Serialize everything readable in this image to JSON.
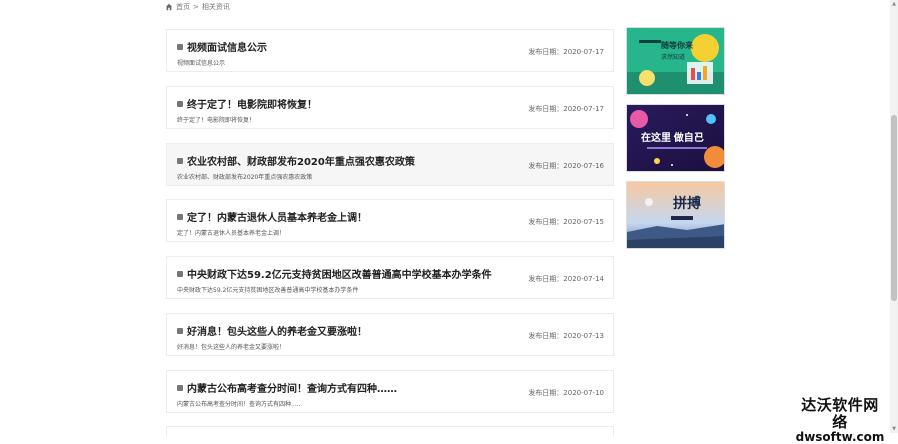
{
  "breadcrumb": {
    "home": "首页",
    "separator": ">",
    "current": "相关资讯"
  },
  "news": [
    {
      "title": "视频面试信息公示",
      "summary": "视频面试信息公示",
      "date": "发布日期：2020-07-17"
    },
    {
      "title": "终于定了！电影院即将恢复！",
      "summary": "终于定了！电影院即将恢复！",
      "date": "发布日期：2020-07-17"
    },
    {
      "title": "农业农村部、财政部发布2020年重点强农惠农政策",
      "summary": "农业农村部、财政部发布2020年重点强农惠农政策",
      "date": "发布日期：2020-07-16"
    },
    {
      "title": "定了！内蒙古退休人员基本养老金上调！",
      "summary": "定了！内蒙古退休人员基本养老金上调！",
      "date": "发布日期：2020-07-15"
    },
    {
      "title": "中央财政下达59.2亿元支持贫困地区改善普通高中学校基本办学条件",
      "summary": "中央财政下达59.2亿元支持贫困地区改善普通高中学校基本办学条件",
      "date": "发布日期：2020-07-14"
    },
    {
      "title": "好消息！包头这些人的养老金又要涨啦！",
      "summary": "好消息！包头这些人的养老金又要涨啦！",
      "date": "发布日期：2020-07-13"
    },
    {
      "title": "内蒙古公布高考查分时间！查询方式有四种……",
      "summary": "内蒙古公布高考查分时间！查询方式有四种.....",
      "date": "发布日期：2020-07-10"
    }
  ],
  "sidebar": {
    "banner1_text": "随等你来\n求然知道",
    "banner2_text": "在这里 做自己",
    "banner3_text": "拼搏"
  },
  "watermark": {
    "main": "达沃软件网络",
    "sub": "dwsoftw.com"
  }
}
